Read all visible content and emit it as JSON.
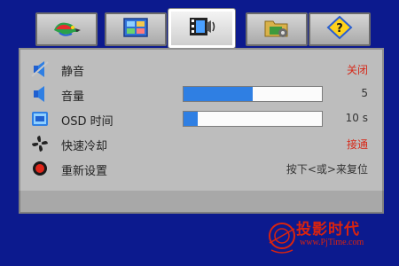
{
  "tabs": [
    {
      "name": "picture",
      "icon": "parrot-icon",
      "active": false
    },
    {
      "name": "image-adjust",
      "icon": "display-adjust-icon",
      "active": false
    },
    {
      "name": "audio-system",
      "icon": "film-audio-icon",
      "active": true
    },
    {
      "name": "pc-setup",
      "icon": "folder-settings-icon",
      "active": false
    },
    {
      "name": "information",
      "icon": "info-diamond-icon",
      "active": false
    }
  ],
  "settings": {
    "mute": {
      "label": "静音",
      "value": "关闭",
      "icon": "speaker-mute-icon"
    },
    "volume": {
      "label": "音量",
      "value": "5",
      "level": 0.5,
      "icon": "speaker-icon"
    },
    "osd_time": {
      "label": "OSD 时间",
      "value": "10 s",
      "level": 0.1,
      "icon": "clock-icon"
    },
    "fast_cooling": {
      "label": "快速冷却",
      "value": "接通",
      "icon": "fan-icon"
    },
    "reset": {
      "label": "重新设置",
      "value": "按下<或>来复位",
      "icon": "record-reset-icon"
    }
  },
  "colors": {
    "background": "#0c1a8e",
    "panel": "#bdbdbd",
    "bar_fill": "#2f7fe3",
    "accent_red": "#d62a1a"
  },
  "watermark": {
    "title": "投影时代",
    "url": "www.PjTime.com"
  }
}
